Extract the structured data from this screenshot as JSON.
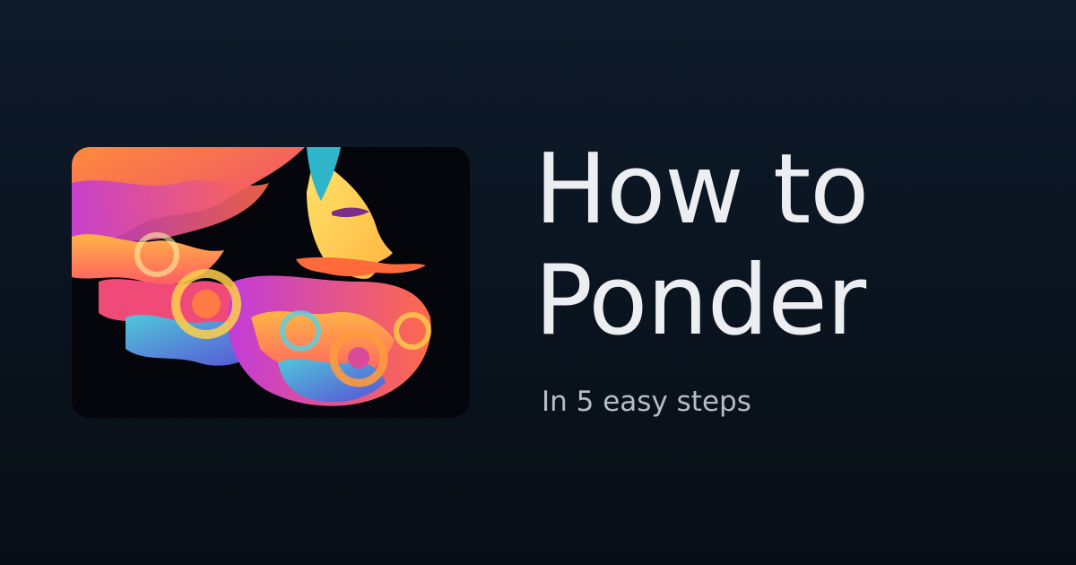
{
  "hero": {
    "title_line1": "How to",
    "title_line2": "Ponder",
    "subtitle": "In 5 easy steps"
  },
  "illustration": {
    "subject": "colorful stylized bearded man profile",
    "background_color": "#05050c"
  },
  "colors": {
    "page_background": "#0b1521",
    "title": "#eceef2",
    "subtitle": "#b6bcc6"
  }
}
